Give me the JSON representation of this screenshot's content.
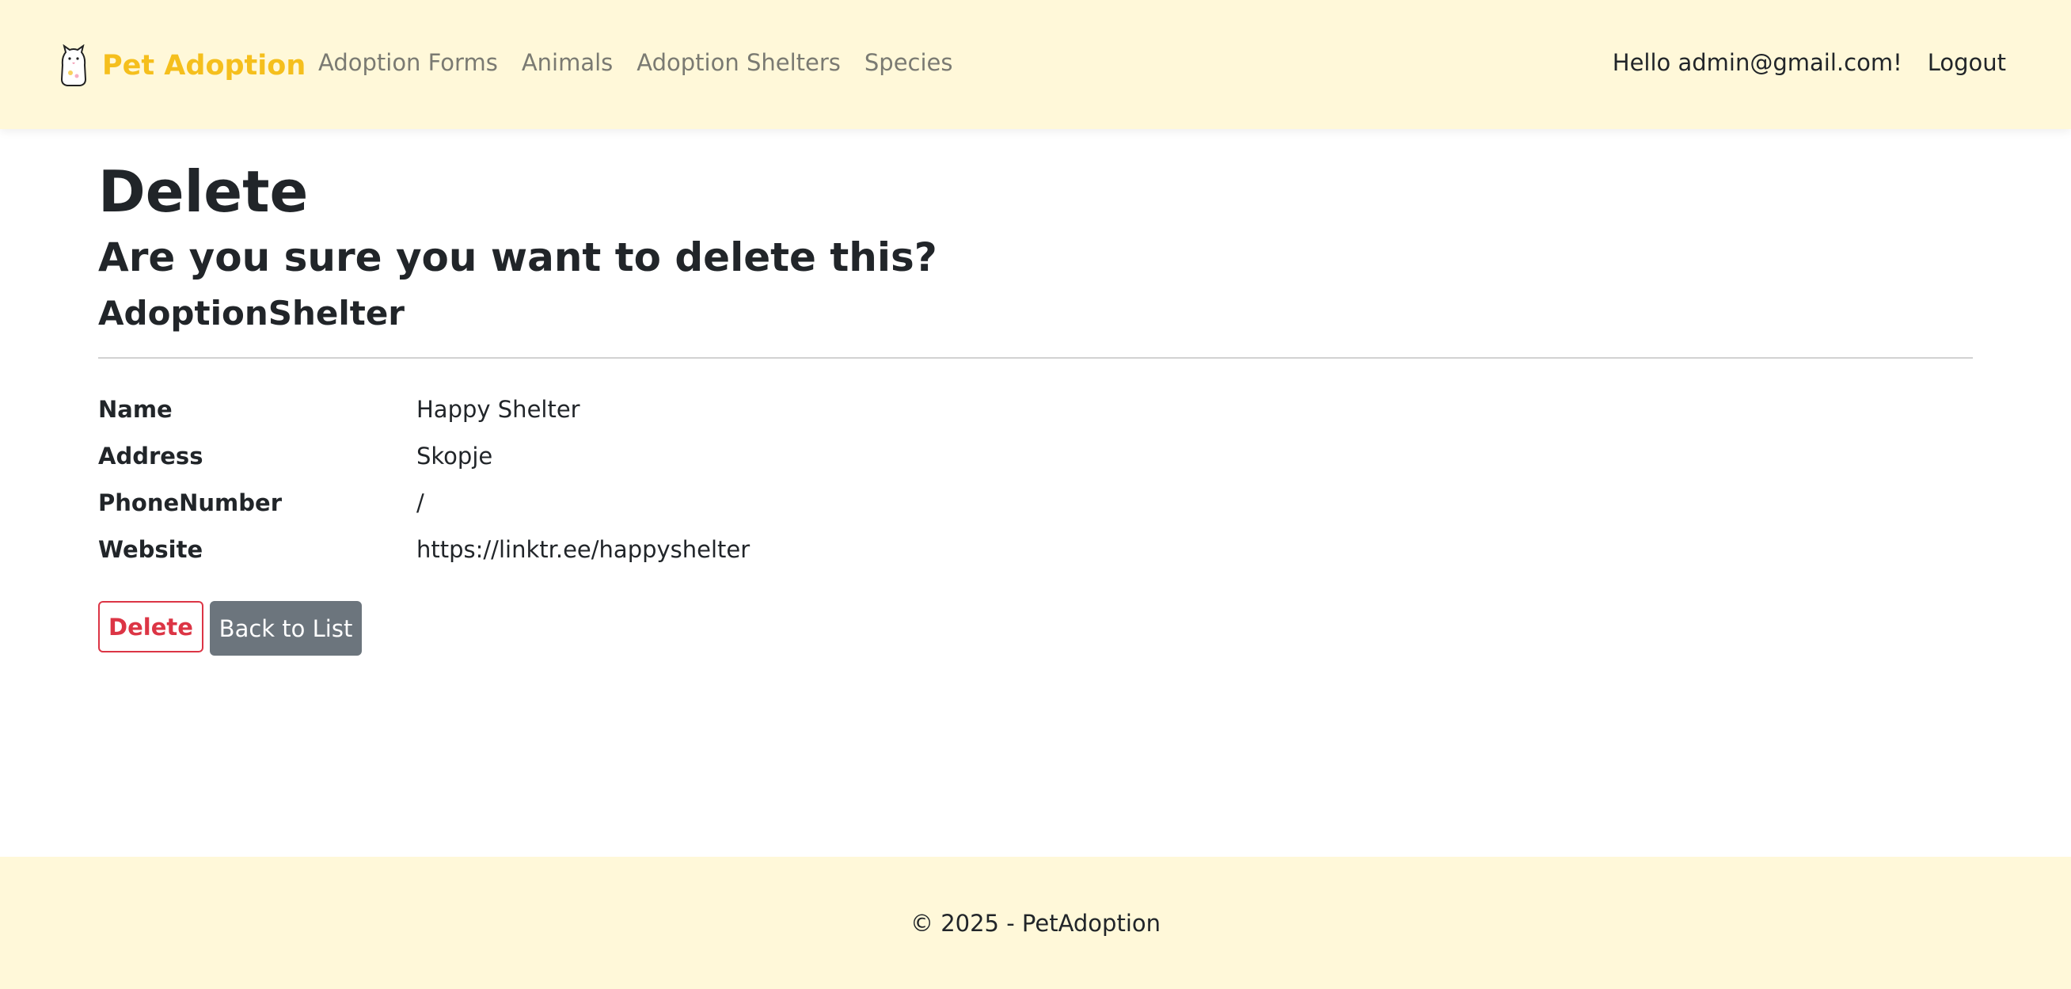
{
  "navbar": {
    "brand": "Pet Adoption",
    "brand_logo_icon": "pet-cat-icon",
    "links": [
      "Adoption Forms",
      "Animals",
      "Adoption Shelters",
      "Species"
    ],
    "greeting": "Hello admin@gmail.com!",
    "logout": "Logout"
  },
  "page": {
    "title": "Delete",
    "question": "Are you sure you want to delete this?",
    "entity": "AdoptionShelter"
  },
  "details": [
    {
      "label": "Name",
      "value": "Happy Shelter"
    },
    {
      "label": "Address",
      "value": "Skopje"
    },
    {
      "label": "PhoneNumber",
      "value": "/"
    },
    {
      "label": "Website",
      "value": "https://linktr.ee/happyshelter"
    }
  ],
  "actions": {
    "delete": "Delete",
    "back": "Back to List"
  },
  "footer": {
    "text": "© 2025 - PetAdoption"
  },
  "colors": {
    "header_bg": "#fff8d9",
    "brand": "#f5bf1d",
    "danger": "#dc3545",
    "secondary": "#6c757d"
  }
}
